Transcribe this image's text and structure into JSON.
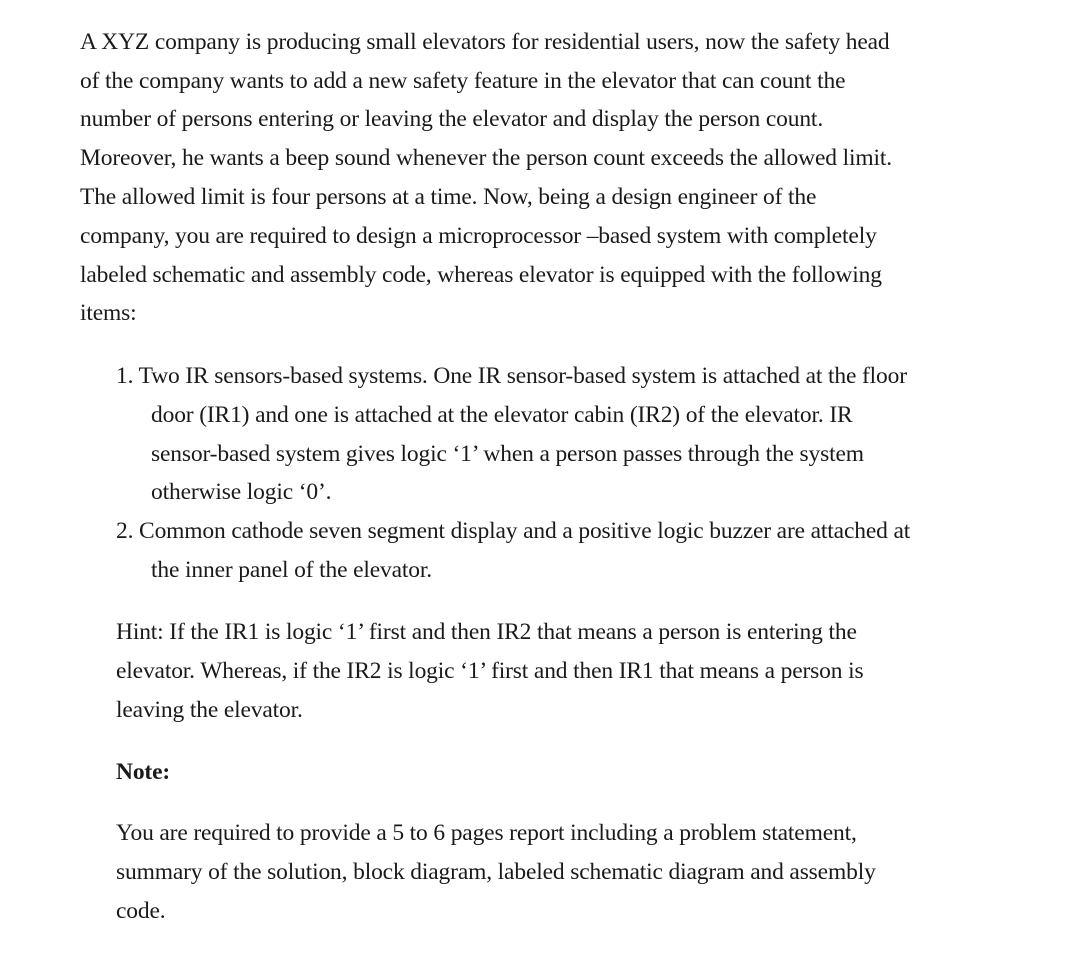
{
  "document": {
    "intro_lines": [
      "A XYZ company is producing small elevators for residential users, now the safety head",
      "of the company wants to add a new safety feature in the elevator that can count the",
      "number of persons entering or leaving the elevator and display the person count.",
      "Moreover, he wants a beep sound whenever the person count exceeds the allowed limit.",
      "The allowed limit is four persons at a time. Now, being a design engineer of the",
      "company, you are required to design a microprocessor –based system with completely",
      "labeled schematic and assembly code, whereas elevator is equipped with the following",
      "items:"
    ],
    "items": [
      {
        "lines": [
          "1. Two IR sensors-based systems. One IR sensor-based system is attached at the floor",
          "door (IR1) and one is attached at the elevator cabin (IR2) of the elevator. IR",
          "sensor-based system gives logic ‘1’ when a person passes through the system",
          "otherwise logic ‘0’."
        ]
      },
      {
        "lines": [
          "2. Common cathode seven segment display and a positive logic buzzer are attached at",
          "the inner panel of the elevator."
        ]
      }
    ],
    "hint_lines": [
      "Hint:  If the IR1 is logic ‘1’ first and then IR2 that means a person is entering the",
      "elevator. Whereas, if the IR2 is logic ‘1’ first and then IR1 that means a person is",
      "leaving the elevator."
    ],
    "note": {
      "heading": "Note:",
      "lines": [
        "You are required to provide a 5 to 6 pages report including a problem statement,",
        "summary of the solution, block diagram, labeled schematic diagram and assembly",
        "code."
      ]
    }
  }
}
